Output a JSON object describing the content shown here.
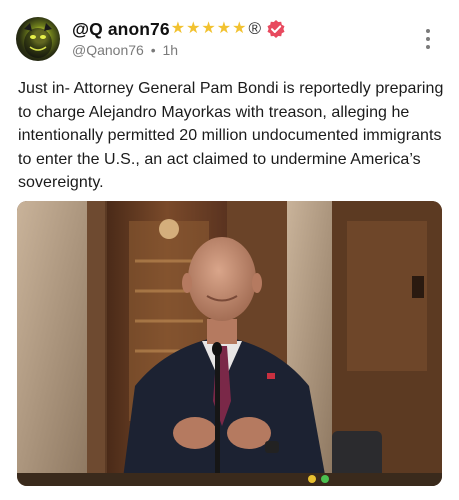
{
  "post": {
    "author": {
      "display_name": "@Q anon76",
      "stars": [
        "★",
        "★",
        "★",
        "★",
        "★"
      ],
      "registered_mark": "®",
      "handle": "@Qanon76",
      "separator": "•",
      "time": "1h"
    },
    "icons": {
      "avatar": "panther-avatar-icon",
      "badge": "verified-badge-icon",
      "menu": "more-options-icon"
    },
    "text": "Just in- Attorney General Pam Bondi is reportedly preparing to charge Alejandro Mayorkas with treason, alleging he intentionally permitted 20 million undocumented immigrants to enter the U.S., an act claimed to undermine America’s sovereignty.",
    "colors": {
      "stars": "#f2c230",
      "verified_badge": "#e84a5f"
    }
  }
}
